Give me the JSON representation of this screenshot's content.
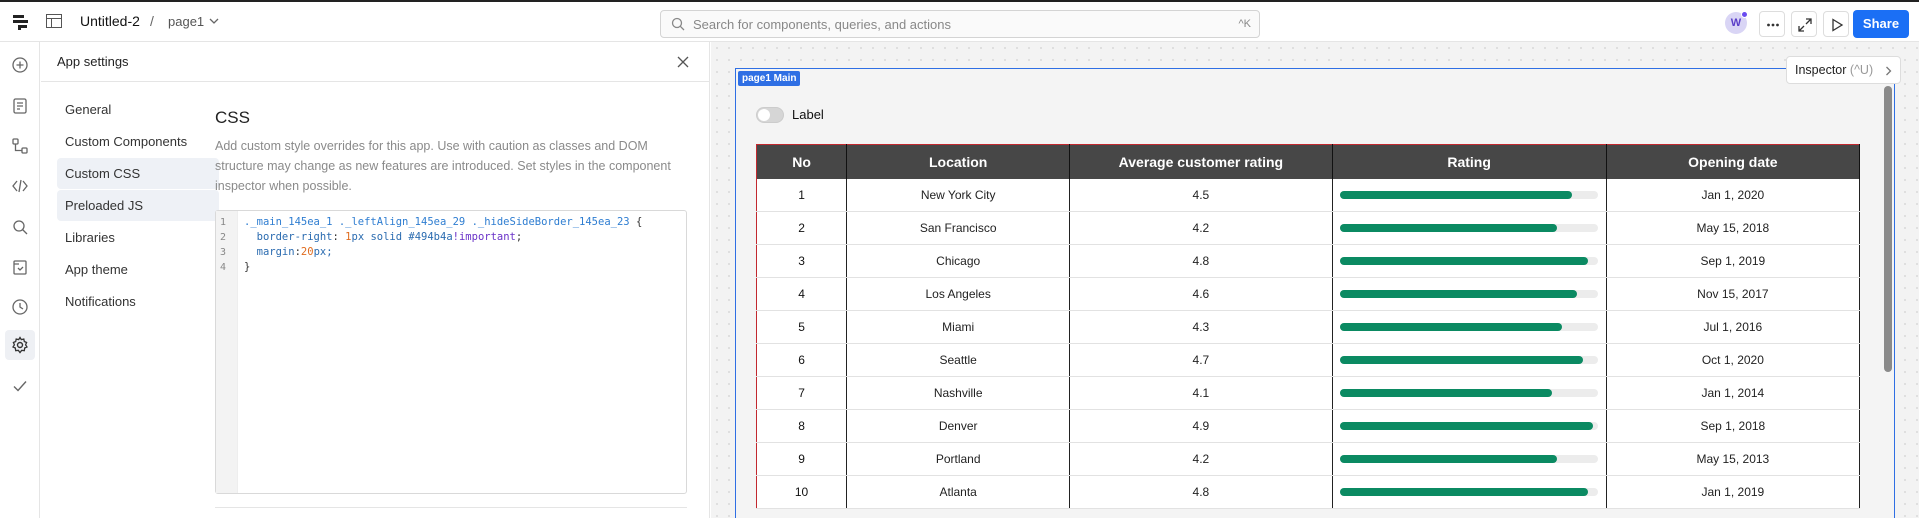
{
  "topbar": {
    "app_name": "Untitled-2",
    "separator": "/",
    "page_name": "page1",
    "search_placeholder": "Search for components, queries, and actions",
    "search_shortcut": "^K",
    "avatar_initial": "W",
    "share_label": "Share",
    "buttons": [
      "more-icon",
      "expand-icon",
      "play-icon"
    ]
  },
  "rail": {
    "icons": [
      "plus-circle-icon",
      "document-icon",
      "tree-icon",
      "code-icon",
      "search-icon",
      "state-icon",
      "history-icon",
      "gear-icon",
      "check-icon"
    ]
  },
  "settings": {
    "title": "App settings",
    "nav": [
      "General",
      "Custom Components",
      "Custom CSS",
      "Preloaded JS",
      "Libraries",
      "App theme",
      "Notifications"
    ],
    "active_nav": "Custom CSS",
    "section_title": "CSS",
    "description": "Add custom style overrides for this app. Use with caution as classes and DOM structure may change as new features are introduced. Set styles in the component inspector when possible.",
    "code": {
      "line_numbers": [
        "1",
        "2",
        "3",
        "4"
      ],
      "l1_selector": "._main_145ea_1 ._leftAlign_145ea_29 ._hideSideBorder_145ea_23",
      "l1_brace": " {",
      "l2_prop": "  border-right",
      "l2_colon": ": ",
      "l2_num": "1",
      "l2_val": "px solid #494b4a",
      "l2_kw": "!important",
      "l2_end": ";",
      "l3_prop": "  margin",
      "l3_colon": ":",
      "l3_num": "20",
      "l3_val": "px;",
      "l4": "}"
    }
  },
  "canvas": {
    "frame_tag": "page1 Main",
    "toggle_label": "Label",
    "inspector_label": "Inspector",
    "inspector_shortcut": "(^U)",
    "bar_color": "#0b8a62",
    "table": {
      "columns": [
        "No",
        "Location",
        "Average customer rating",
        "Rating",
        "Opening date"
      ],
      "rows": [
        {
          "no": "1",
          "location": "New York City",
          "avg": "4.5",
          "rating": 0.9,
          "date": "Jan 1, 2020"
        },
        {
          "no": "2",
          "location": "San Francisco",
          "avg": "4.2",
          "rating": 0.84,
          "date": "May 15, 2018"
        },
        {
          "no": "3",
          "location": "Chicago",
          "avg": "4.8",
          "rating": 0.96,
          "date": "Sep 1, 2019"
        },
        {
          "no": "4",
          "location": "Los Angeles",
          "avg": "4.6",
          "rating": 0.92,
          "date": "Nov 15, 2017"
        },
        {
          "no": "5",
          "location": "Miami",
          "avg": "4.3",
          "rating": 0.86,
          "date": "Jul 1, 2016"
        },
        {
          "no": "6",
          "location": "Seattle",
          "avg": "4.7",
          "rating": 0.94,
          "date": "Oct 1, 2020"
        },
        {
          "no": "7",
          "location": "Nashville",
          "avg": "4.1",
          "rating": 0.82,
          "date": "Jan 1, 2014"
        },
        {
          "no": "8",
          "location": "Denver",
          "avg": "4.9",
          "rating": 0.98,
          "date": "Sep 1, 2018"
        },
        {
          "no": "9",
          "location": "Portland",
          "avg": "4.2",
          "rating": 0.84,
          "date": "May 15, 2013"
        },
        {
          "no": "10",
          "location": "Atlanta",
          "avg": "4.8",
          "rating": 0.96,
          "date": "Jan 1, 2019"
        }
      ]
    }
  }
}
